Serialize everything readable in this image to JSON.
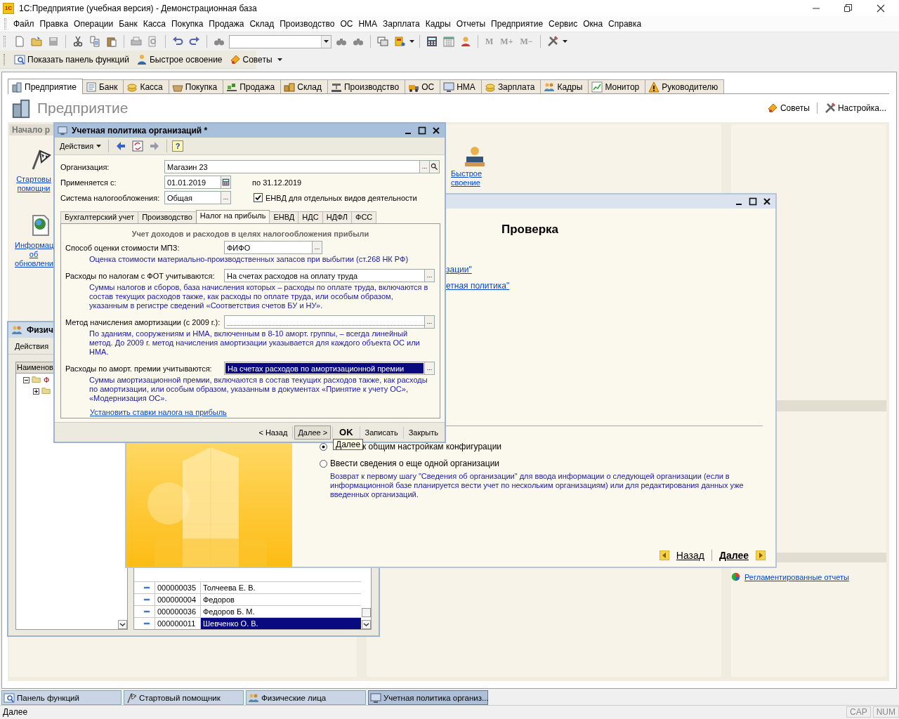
{
  "app": {
    "title": "1С:Предприятие (учебная версия) - Демонстрационная база",
    "logo": "1С"
  },
  "menu": [
    {
      "label": "Файл"
    },
    {
      "label": "Правка"
    },
    {
      "label": "Операции"
    },
    {
      "label": "Банк"
    },
    {
      "label": "Касса"
    },
    {
      "label": "Покупка"
    },
    {
      "label": "Продажа"
    },
    {
      "label": "Склад"
    },
    {
      "label": "Производство"
    },
    {
      "label": "ОС"
    },
    {
      "label": "НМА"
    },
    {
      "label": "Зарплата"
    },
    {
      "label": "Кадры"
    },
    {
      "label": "Отчеты"
    },
    {
      "label": "Предприятие"
    },
    {
      "label": "Сервис"
    },
    {
      "label": "Окна"
    },
    {
      "label": "Справка"
    }
  ],
  "memory_buttons": [
    {
      "label": "M",
      "disabled": true
    },
    {
      "label": "M+",
      "disabled": true
    },
    {
      "label": "M−",
      "disabled": true
    }
  ],
  "quick_toolbar": [
    {
      "label": "Показать панель функций"
    },
    {
      "label": "Быстрое освоение"
    },
    {
      "label": "Советы"
    }
  ],
  "tabs": [
    {
      "label": "Предприятие",
      "selected": true
    },
    {
      "label": "Банк",
      "selected": false
    },
    {
      "label": "Касса",
      "selected": false
    },
    {
      "label": "Покупка",
      "selected": false
    },
    {
      "label": "Продажа",
      "selected": false
    },
    {
      "label": "Склад",
      "selected": false
    },
    {
      "label": "Производство",
      "selected": false
    },
    {
      "label": "ОС",
      "selected": false
    },
    {
      "label": "НМА",
      "selected": false
    },
    {
      "label": "Зарплата",
      "selected": false
    },
    {
      "label": "Кадры",
      "selected": false
    },
    {
      "label": "Монитор",
      "selected": false
    },
    {
      "label": "Руководителю",
      "selected": false
    }
  ],
  "panel": {
    "title": "Предприятие",
    "links": [
      "Советы",
      "Настройка..."
    ],
    "section_label": "Начало р",
    "start_links": [
      {
        "lines": [
          "Стартовы",
          "помощни"
        ]
      },
      {
        "lines": [
          "Информац",
          "об",
          "обновлени"
        ]
      }
    ],
    "quick_link": {
      "lines": [
        "Быстрое",
        "своение"
      ]
    },
    "reports_link": "Регламентированные отчеты"
  },
  "persons_window": {
    "title": "Физич",
    "actions": "Действия",
    "tree_header": "Наименов",
    "tree": [
      {
        "label": "Ф",
        "expanded": true,
        "children": [
          {
            "expanded": false
          }
        ]
      }
    ],
    "rows": [
      {
        "code": "000000035",
        "name": "Толчеева Е. В.",
        "selected": false
      },
      {
        "code": "000000004",
        "name": "Федоров",
        "selected": false
      },
      {
        "code": "000000036",
        "name": "Федоров Б. М.",
        "selected": false
      },
      {
        "code": "000000011",
        "name": "Шевченко О. В.",
        "selected": true
      }
    ]
  },
  "wizard": {
    "heading": "Проверка",
    "links": [
      "зации\"",
      "етная политика\""
    ],
    "options": [
      {
        "label": "к общим настройкам конфигурации",
        "selected": true
      },
      {
        "label": "Ввести сведения о еще одной организации",
        "selected": false,
        "description": "Возврат к первому шагу \"Сведения об организации\" для ввода информации о следующей организации (если в информационной базе планируется вести учет по нескольким организациям) или для редактирования данных уже введенных организаций."
      }
    ],
    "back": "Назад",
    "next": "Далее"
  },
  "dialog": {
    "title": "Учетная политика организаций *",
    "actions": "Действия",
    "help": "?",
    "header_fields": [
      {
        "label": "Организация:",
        "value": "Магазин 23",
        "kind": "wide",
        "buttons": [
          {
            "kind": "choice",
            "text": "..."
          },
          {
            "kind": "search"
          }
        ]
      },
      {
        "label": "Применяется с:",
        "value": "01.01.2019",
        "kind": "date",
        "buttons": [
          {
            "kind": "calendar"
          }
        ],
        "note": "по 31.12.2019"
      },
      {
        "label": "Система налогообложения:",
        "value": "Общая",
        "kind": "date",
        "buttons": [
          {
            "kind": "choice",
            "text": "..."
          }
        ],
        "checkbox": {
          "label": "ЕНВД для отдельных видов деятельности",
          "checked": true
        }
      }
    ],
    "tabs": [
      {
        "label": "Бухгалтерский учет",
        "selected": false
      },
      {
        "label": "Производство",
        "selected": false
      },
      {
        "label": "Налог на прибыль",
        "selected": true
      },
      {
        "label": "ЕНВД",
        "selected": false
      },
      {
        "label": "НДС",
        "selected": false
      },
      {
        "label": "НДФЛ",
        "selected": false
      },
      {
        "label": "ФСС",
        "selected": false
      }
    ],
    "section_title": "Учет доходов и расходов в целях налогообложения прибыли",
    "fields": [
      {
        "label": "Способ оценки стоимости МПЗ:",
        "value": "ФИФО",
        "kind": "short",
        "button": "...",
        "focused": false,
        "invalid": false,
        "hint": "Оценка стоимости материально-производственных запасов при выбытии (ст.268 НК РФ)"
      },
      {
        "label": "Расходы по налогам с ФОТ учитываются:",
        "value": "На счетах расходов на оплату труда",
        "kind": "wide",
        "button": "...",
        "focused": false,
        "invalid": false,
        "hint": "Суммы налогов и сборов, база начисления которых – расходы по оплате труда, включаются в состав текущих расходов также, как расходы по оплате труда, или особым образом, указанным в регистре сведений «Соответствия счетов БУ и НУ»."
      },
      {
        "label": "Метод начисления амортизации (с 2009 г.):",
        "kind": "wide",
        "button": "...",
        "focused": false,
        "invalid": true,
        "hint": "По зданиям, сооружениям и НМА, включенным в 8-10 аморт. группы, – всегда линейный метод. До 2009 г. метод начисления амортизации указывается для каждого объекта ОС или НМА."
      },
      {
        "label": "Расходы по аморт. премии учитываются:",
        "value": "На счетах расходов по амортизационной премии",
        "kind": "wide",
        "button": "...",
        "focused": true,
        "invalid": false,
        "hint": "Суммы амортизационной премии, включаются в состав текущих расходов также, как расходы по амортизации, или особым образом, указанным в документах «Принятие к учету ОС», «Модернизация ОС»."
      }
    ],
    "link": "Установить ставки налога на прибыль",
    "buttons": [
      {
        "label": "< Назад",
        "kind": "plain",
        "highlighted": false
      },
      {
        "label": "Далее >",
        "kind": "plain",
        "highlighted": true
      },
      {
        "label": "OK",
        "kind": "default",
        "highlighted": false
      },
      {
        "label": "Записать",
        "kind": "plain",
        "highlighted": false
      },
      {
        "label": "Закрыть",
        "kind": "plain",
        "highlighted": false
      }
    ]
  },
  "tooltip": "Далее",
  "taskbar": [
    {
      "label": "Панель функций",
      "selected": false
    },
    {
      "label": "Стартовый помощник",
      "selected": false
    },
    {
      "label": "Физические лица",
      "selected": false
    },
    {
      "label": "Учетная политика организ...",
      "selected": true
    }
  ],
  "status": {
    "text": "Далее",
    "indicators": [
      "CAP",
      "NUM"
    ]
  }
}
